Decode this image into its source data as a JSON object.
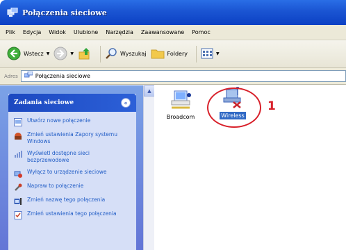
{
  "window": {
    "title": "Połączenia sieciowe"
  },
  "menu": [
    "Plik",
    "Edycja",
    "Widok",
    "Ulubione",
    "Narzędzia",
    "Zaawansowane",
    "Pomoc"
  ],
  "toolbar": {
    "back_label": "Wstecz",
    "search_label": "Wyszukaj",
    "folders_label": "Foldery"
  },
  "address": {
    "label": "Adres",
    "value": "Połączenia sieciowe"
  },
  "tasks": {
    "header": "Zadania sieciowe",
    "items": [
      {
        "label": "Utwórz nowe połączenie",
        "icon": "new-connection-icon"
      },
      {
        "label": "Zmień ustawienia Zapory systemu Windows",
        "icon": "firewall-icon"
      },
      {
        "label": "Wyświetl dostępne sieci bezprzewodowe",
        "icon": "wireless-networks-icon"
      },
      {
        "label": "Wyłącz to urządzenie sieciowe",
        "icon": "disable-device-icon"
      },
      {
        "label": "Napraw to połączenie",
        "icon": "repair-icon"
      },
      {
        "label": "Zmień nazwę tego połączenia",
        "icon": "rename-icon"
      },
      {
        "label": "Zmień ustawienia tego połączenia",
        "icon": "properties-icon"
      }
    ]
  },
  "connections": [
    {
      "label": "Broadcom",
      "selected": false
    },
    {
      "label": "Wireless",
      "selected": true
    }
  ],
  "callout": "1",
  "colors": {
    "accent": "#316ac5",
    "callout": "#d8202a",
    "title_bar": "#1a54d2"
  }
}
